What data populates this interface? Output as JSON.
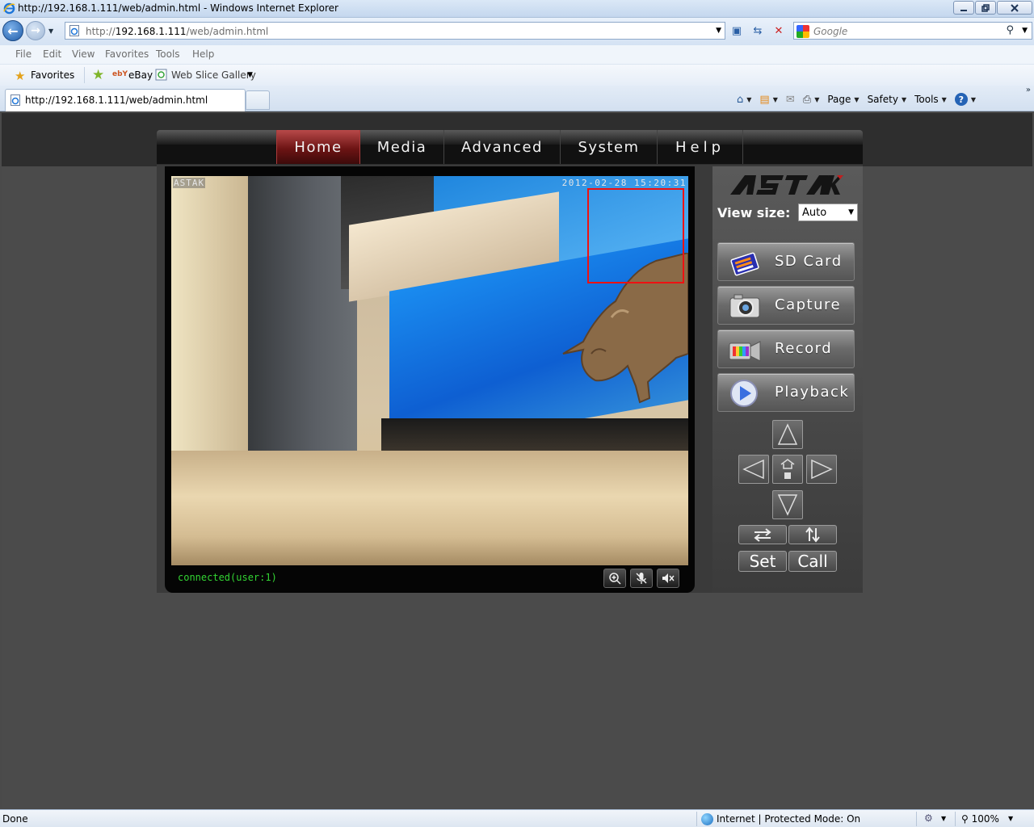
{
  "browser": {
    "window_title": "http://192.168.1.111/web/admin.html - Windows Internet Explorer",
    "address_prefix": "http://",
    "address_host": "192.168.1.111",
    "address_path": "/web/admin.html",
    "search_placeholder": "Google",
    "menu": [
      "File",
      "Edit",
      "View",
      "Favorites",
      "Tools",
      "Help"
    ],
    "favorites_label": "Favorites",
    "fav_links": {
      "ebay": "eBay",
      "ebay_logo": "ebY",
      "web_slice": "Web Slice Gallery"
    },
    "tab_title": "http://192.168.1.111/web/admin.html",
    "command_bar": {
      "page": "Page",
      "safety": "Safety",
      "tools": "Tools"
    },
    "status": {
      "left": "Done",
      "zone": "Internet | Protected Mode: On",
      "zoom": "100%"
    }
  },
  "camera_ui": {
    "nav": [
      "Home",
      "Media",
      "Advanced",
      "System",
      "Help"
    ],
    "active_nav": "Home",
    "osd_brand": "ASTAK",
    "osd_timestamp": "2012-02-28 15:20:31",
    "connection_status": "connected(user:1)",
    "logo": {
      "text": "ASTAK"
    },
    "view_size_label": "View size:",
    "view_size_value": "Auto",
    "action_buttons": [
      "SD Card",
      "Capture",
      "Record",
      "Playback"
    ],
    "preset_buttons": {
      "set": "Set",
      "call": "Call"
    }
  },
  "colors": {
    "active_tab": "#8a1e1e",
    "status_text": "#33d433",
    "motion_box": "#e11111",
    "logo_accent": "#c21f1f"
  }
}
